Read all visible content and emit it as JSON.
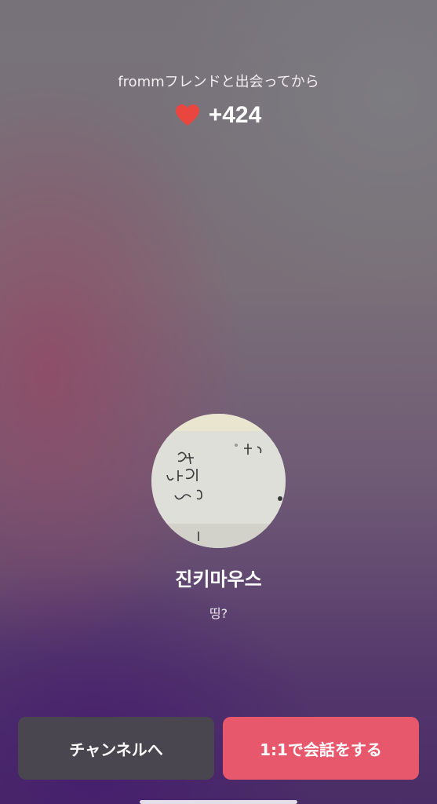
{
  "header": {
    "caption": "frommフレンドと出会ってから",
    "score": "+424",
    "heart_icon": "heart-icon",
    "heart_color": "#e8463f"
  },
  "profile": {
    "name": "진키마우스",
    "status": "띵?"
  },
  "actions": {
    "channel_label": "チャンネルへ",
    "chat_label": "1:1で会話をする",
    "channel_color": "#4a4650",
    "chat_color": "#e8586d"
  }
}
